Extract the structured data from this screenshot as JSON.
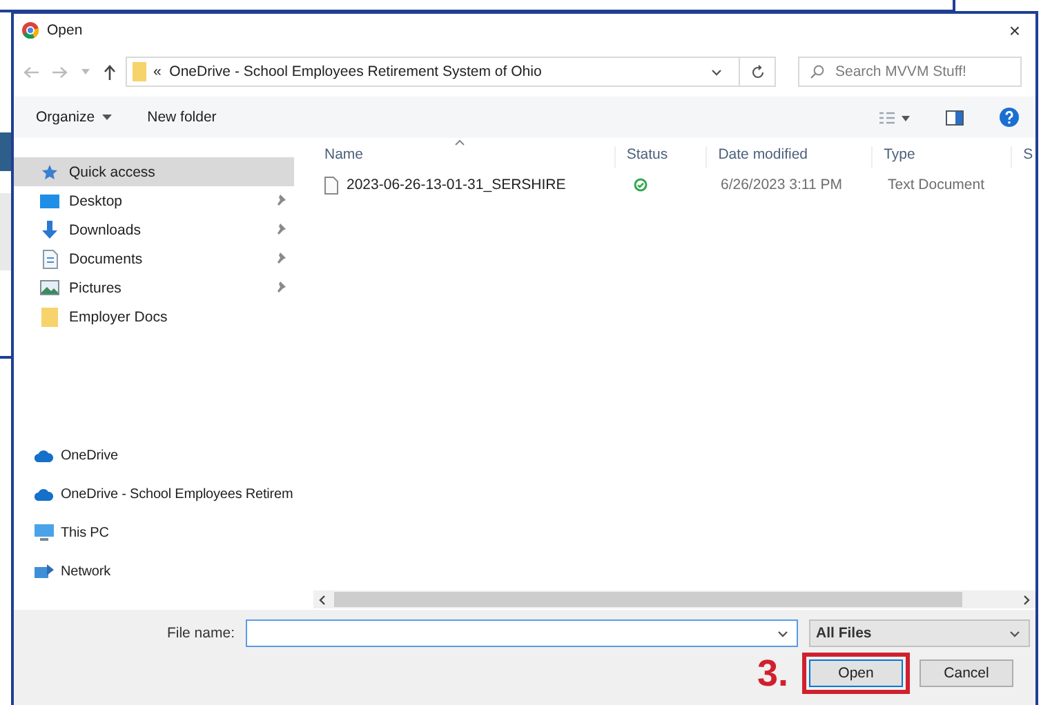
{
  "window": {
    "title": "Open",
    "close": "×"
  },
  "address_bar": {
    "overflow_marker": "«",
    "path": "OneDrive - School Employees Retirement System of Ohio",
    "search_placeholder": "Search MVVM Stuff!"
  },
  "toolbar": {
    "organize": "Organize",
    "new_folder": "New folder"
  },
  "sidebar": {
    "quick_access": [
      {
        "label": "Quick access",
        "kind": "star",
        "selected": true,
        "pinned": false
      },
      {
        "label": "Desktop",
        "kind": "desktop",
        "selected": false,
        "pinned": true
      },
      {
        "label": "Downloads",
        "kind": "download",
        "selected": false,
        "pinned": true
      },
      {
        "label": "Documents",
        "kind": "document",
        "selected": false,
        "pinned": true
      },
      {
        "label": "Pictures",
        "kind": "picture",
        "selected": false,
        "pinned": true
      },
      {
        "label": "Employer Docs",
        "kind": "folder",
        "selected": false,
        "pinned": false
      }
    ],
    "locations": [
      {
        "label": "OneDrive",
        "kind": "cloud",
        "selected": false
      },
      {
        "label": "OneDrive - School Employees Retirem",
        "kind": "cloud",
        "selected": false
      },
      {
        "label": "This PC",
        "kind": "pc",
        "selected": false
      },
      {
        "label": "Network",
        "kind": "network",
        "selected": false
      }
    ]
  },
  "file_list": {
    "columns": [
      "Name",
      "Status",
      "Date modified",
      "Type",
      "S"
    ],
    "rows": [
      {
        "name": "2023-06-26-13-01-31_SERSHIRE",
        "kind": "synced",
        "date_modified": "6/26/2023 3:11 PM",
        "type": "Text Document"
      }
    ]
  },
  "footer": {
    "file_name_label": "File name:",
    "file_type": "All Files",
    "open_button": {
      "label": "Open",
      "annotated": true
    },
    "cancel_button": "Cancel"
  },
  "annotation": {
    "label": "3."
  }
}
